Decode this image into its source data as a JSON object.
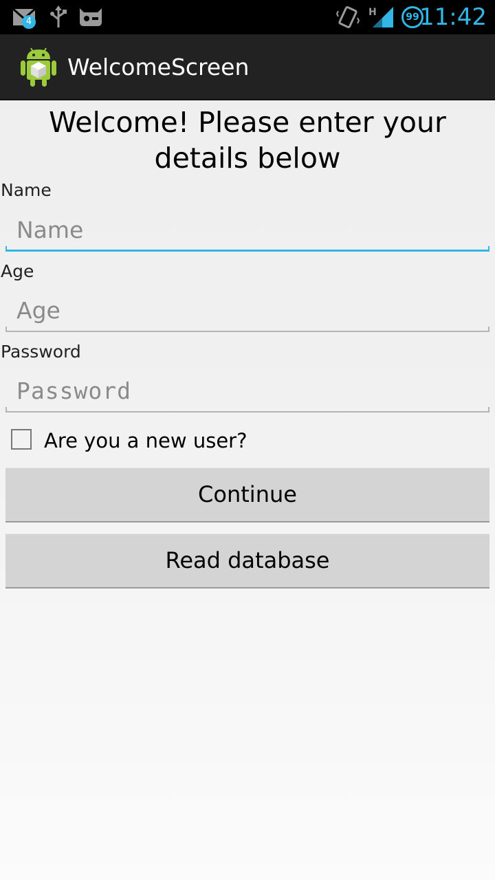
{
  "status_bar": {
    "mail_count": "4",
    "battery_level": "99",
    "time": "11:42",
    "network_type": "H",
    "icons": [
      "gmail-icon",
      "usb-icon",
      "cyanogenmod-icon",
      "vibrate-icon",
      "signal-icon",
      "battery-icon"
    ],
    "accent_color": "#33b5e5"
  },
  "action_bar": {
    "title": "WelcomeScreen",
    "icon": "android-app-icon"
  },
  "form": {
    "heading": "Welcome! Please enter your details below",
    "name_label": "Name",
    "name_placeholder": "Name",
    "name_value": "",
    "age_label": "Age",
    "age_placeholder": "Age",
    "age_value": "",
    "password_label": "Password",
    "password_placeholder": "Password",
    "password_value": "",
    "new_user_label": "Are you a new user?",
    "new_user_checked": false,
    "continue_label": "Continue",
    "read_db_label": "Read database"
  }
}
